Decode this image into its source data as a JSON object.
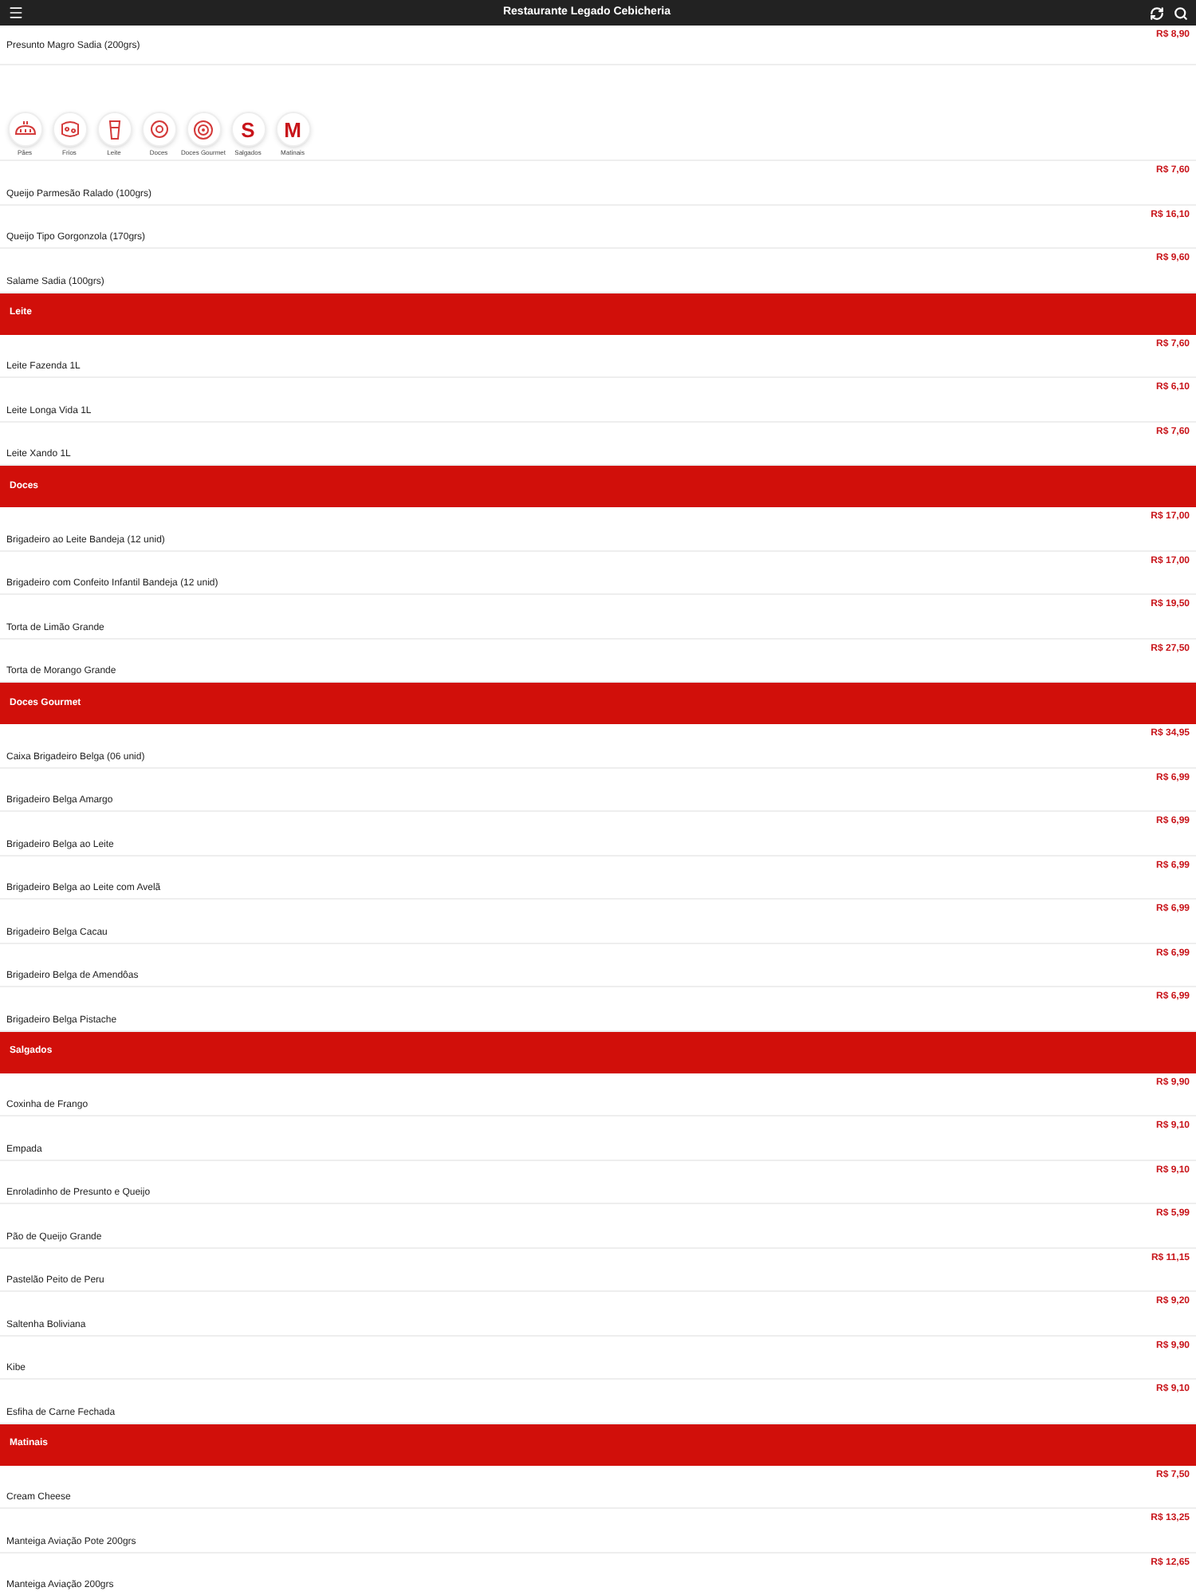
{
  "app_bar": {
    "title": "Restaurante Legado Cebicheria"
  },
  "top_item": {
    "name": "Presunto Magro Sadia (200grs)",
    "price": "R$ 8,90"
  },
  "categories": [
    {
      "kind": "bread",
      "label": "Pães"
    },
    {
      "kind": "cold-cuts",
      "label": "Frios"
    },
    {
      "kind": "glass",
      "label": "Leite"
    },
    {
      "kind": "donut",
      "label": "Doces"
    },
    {
      "kind": "plate",
      "label": "Doces Gourmet"
    },
    {
      "kind": "letter",
      "letter": "S",
      "label": "Salgados"
    },
    {
      "kind": "letter",
      "letter": "M",
      "label": "Matinais"
    }
  ],
  "sections": [
    {
      "items": [
        {
          "name": "Queijo Parmesão Ralado (100grs)",
          "price": "R$ 7,60"
        },
        {
          "name": "Queijo Tipo Gorgonzola (170grs)",
          "price": "R$ 16,10"
        },
        {
          "name": "Salame Sadia (100grs)",
          "price": "R$ 9,60"
        }
      ]
    },
    {
      "title": "Leite",
      "items": [
        {
          "name": "Leite Fazenda 1L",
          "price": "R$ 7,60"
        },
        {
          "name": "Leite Longa Vida 1L",
          "price": "R$ 6,10"
        },
        {
          "name": "Leite Xando 1L",
          "price": "R$ 7,60"
        }
      ]
    },
    {
      "title": "Doces",
      "items": [
        {
          "name": "Brigadeiro ao Leite Bandeja (12 unid)",
          "price": "R$ 17,00"
        },
        {
          "name": "Brigadeiro com Confeito Infantil Bandeja (12 unid)",
          "price": "R$ 17,00"
        },
        {
          "name": "Torta de Limão Grande",
          "price": "R$ 19,50"
        },
        {
          "name": "Torta de Morango Grande",
          "price": "R$ 27,50"
        }
      ]
    },
    {
      "title": "Doces Gourmet",
      "items": [
        {
          "name": "Caixa Brigadeiro Belga (06 unid)",
          "price": "R$ 34,95"
        },
        {
          "name": "Brigadeiro Belga Amargo",
          "price": "R$ 6,99"
        },
        {
          "name": "Brigadeiro Belga ao Leite",
          "price": "R$ 6,99"
        },
        {
          "name": "Brigadeiro Belga ao Leite com Avelã",
          "price": "R$ 6,99"
        },
        {
          "name": "Brigadeiro Belga Cacau",
          "price": "R$ 6,99"
        },
        {
          "name": "Brigadeiro Belga de Amendôas",
          "price": "R$ 6,99"
        },
        {
          "name": "Brigadeiro Belga Pistache",
          "price": "R$ 6,99"
        }
      ]
    },
    {
      "title": "Salgados",
      "items": [
        {
          "name": "Coxinha de Frango",
          "price": "R$ 9,90"
        },
        {
          "name": "Empada",
          "price": "R$ 9,10"
        },
        {
          "name": "Enroladinho de Presunto e Queijo",
          "price": "R$ 9,10"
        },
        {
          "name": "Pão de Queijo Grande",
          "price": "R$ 5,99"
        },
        {
          "name": "Pastelão Peito de Peru",
          "price": "R$ 11,15"
        },
        {
          "name": "Saltenha Boliviana",
          "price": "R$ 9,20"
        },
        {
          "name": "Kibe",
          "price": "R$ 9,90"
        },
        {
          "name": "Esfiha de Carne Fechada",
          "price": "R$ 9,10"
        }
      ]
    },
    {
      "title": "Matinais",
      "items": [
        {
          "name": "Cream Cheese",
          "price": "R$ 7,50"
        },
        {
          "name": "Manteiga Aviação Pote 200grs",
          "price": "R$ 13,25"
        },
        {
          "name": "Manteiga Aviação 200grs",
          "price": "R$ 12,65"
        }
      ]
    }
  ]
}
